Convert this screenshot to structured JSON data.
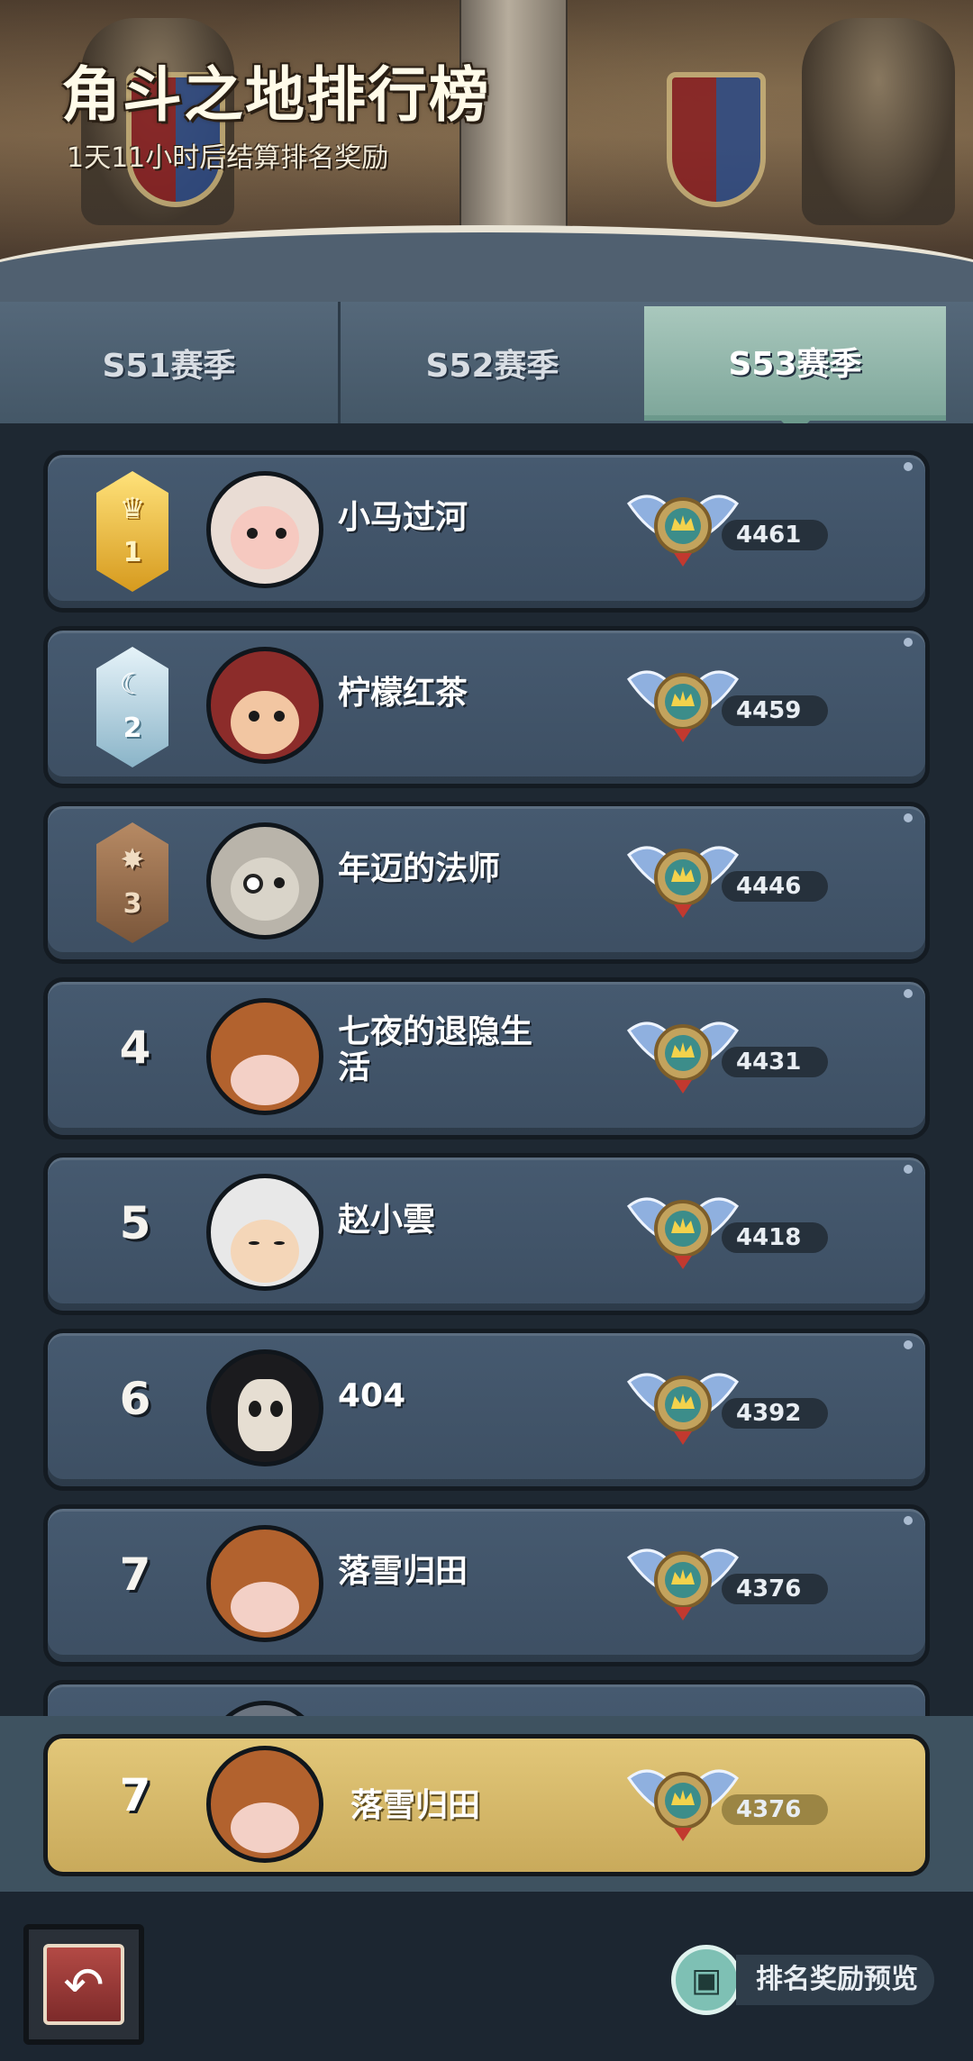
{
  "header": {
    "title": "角斗之地排行榜",
    "subtitle": "1天11小时后结算排名奖励"
  },
  "tabs": [
    {
      "label": "S51赛季",
      "selected": false
    },
    {
      "label": "S52赛季",
      "selected": false
    },
    {
      "label": "S53赛季",
      "selected": true
    }
  ],
  "rankings": [
    {
      "rank": "1",
      "name": "小马过河",
      "score": "4461",
      "badge": "gold"
    },
    {
      "rank": "2",
      "name": "柠檬红茶",
      "score": "4459",
      "badge": "silver"
    },
    {
      "rank": "3",
      "name": "年迈的法师",
      "score": "4446",
      "badge": "bronze"
    },
    {
      "rank": "4",
      "name": "七夜的退隐生活",
      "score": "4431"
    },
    {
      "rank": "5",
      "name": "赵小雲",
      "score": "4418"
    },
    {
      "rank": "6",
      "name": "404",
      "score": "4392"
    },
    {
      "rank": "7",
      "name": "落雪归田",
      "score": "4376"
    }
  ],
  "self": {
    "rank": "7",
    "name": "落雪归田",
    "score": "4376"
  },
  "footer": {
    "reward_preview_label": "排名奖励预览"
  },
  "colors": {
    "accent_tab": "#8fb5a9",
    "self_highlight": "#d8bd6c",
    "row_bg": "#42556a"
  }
}
